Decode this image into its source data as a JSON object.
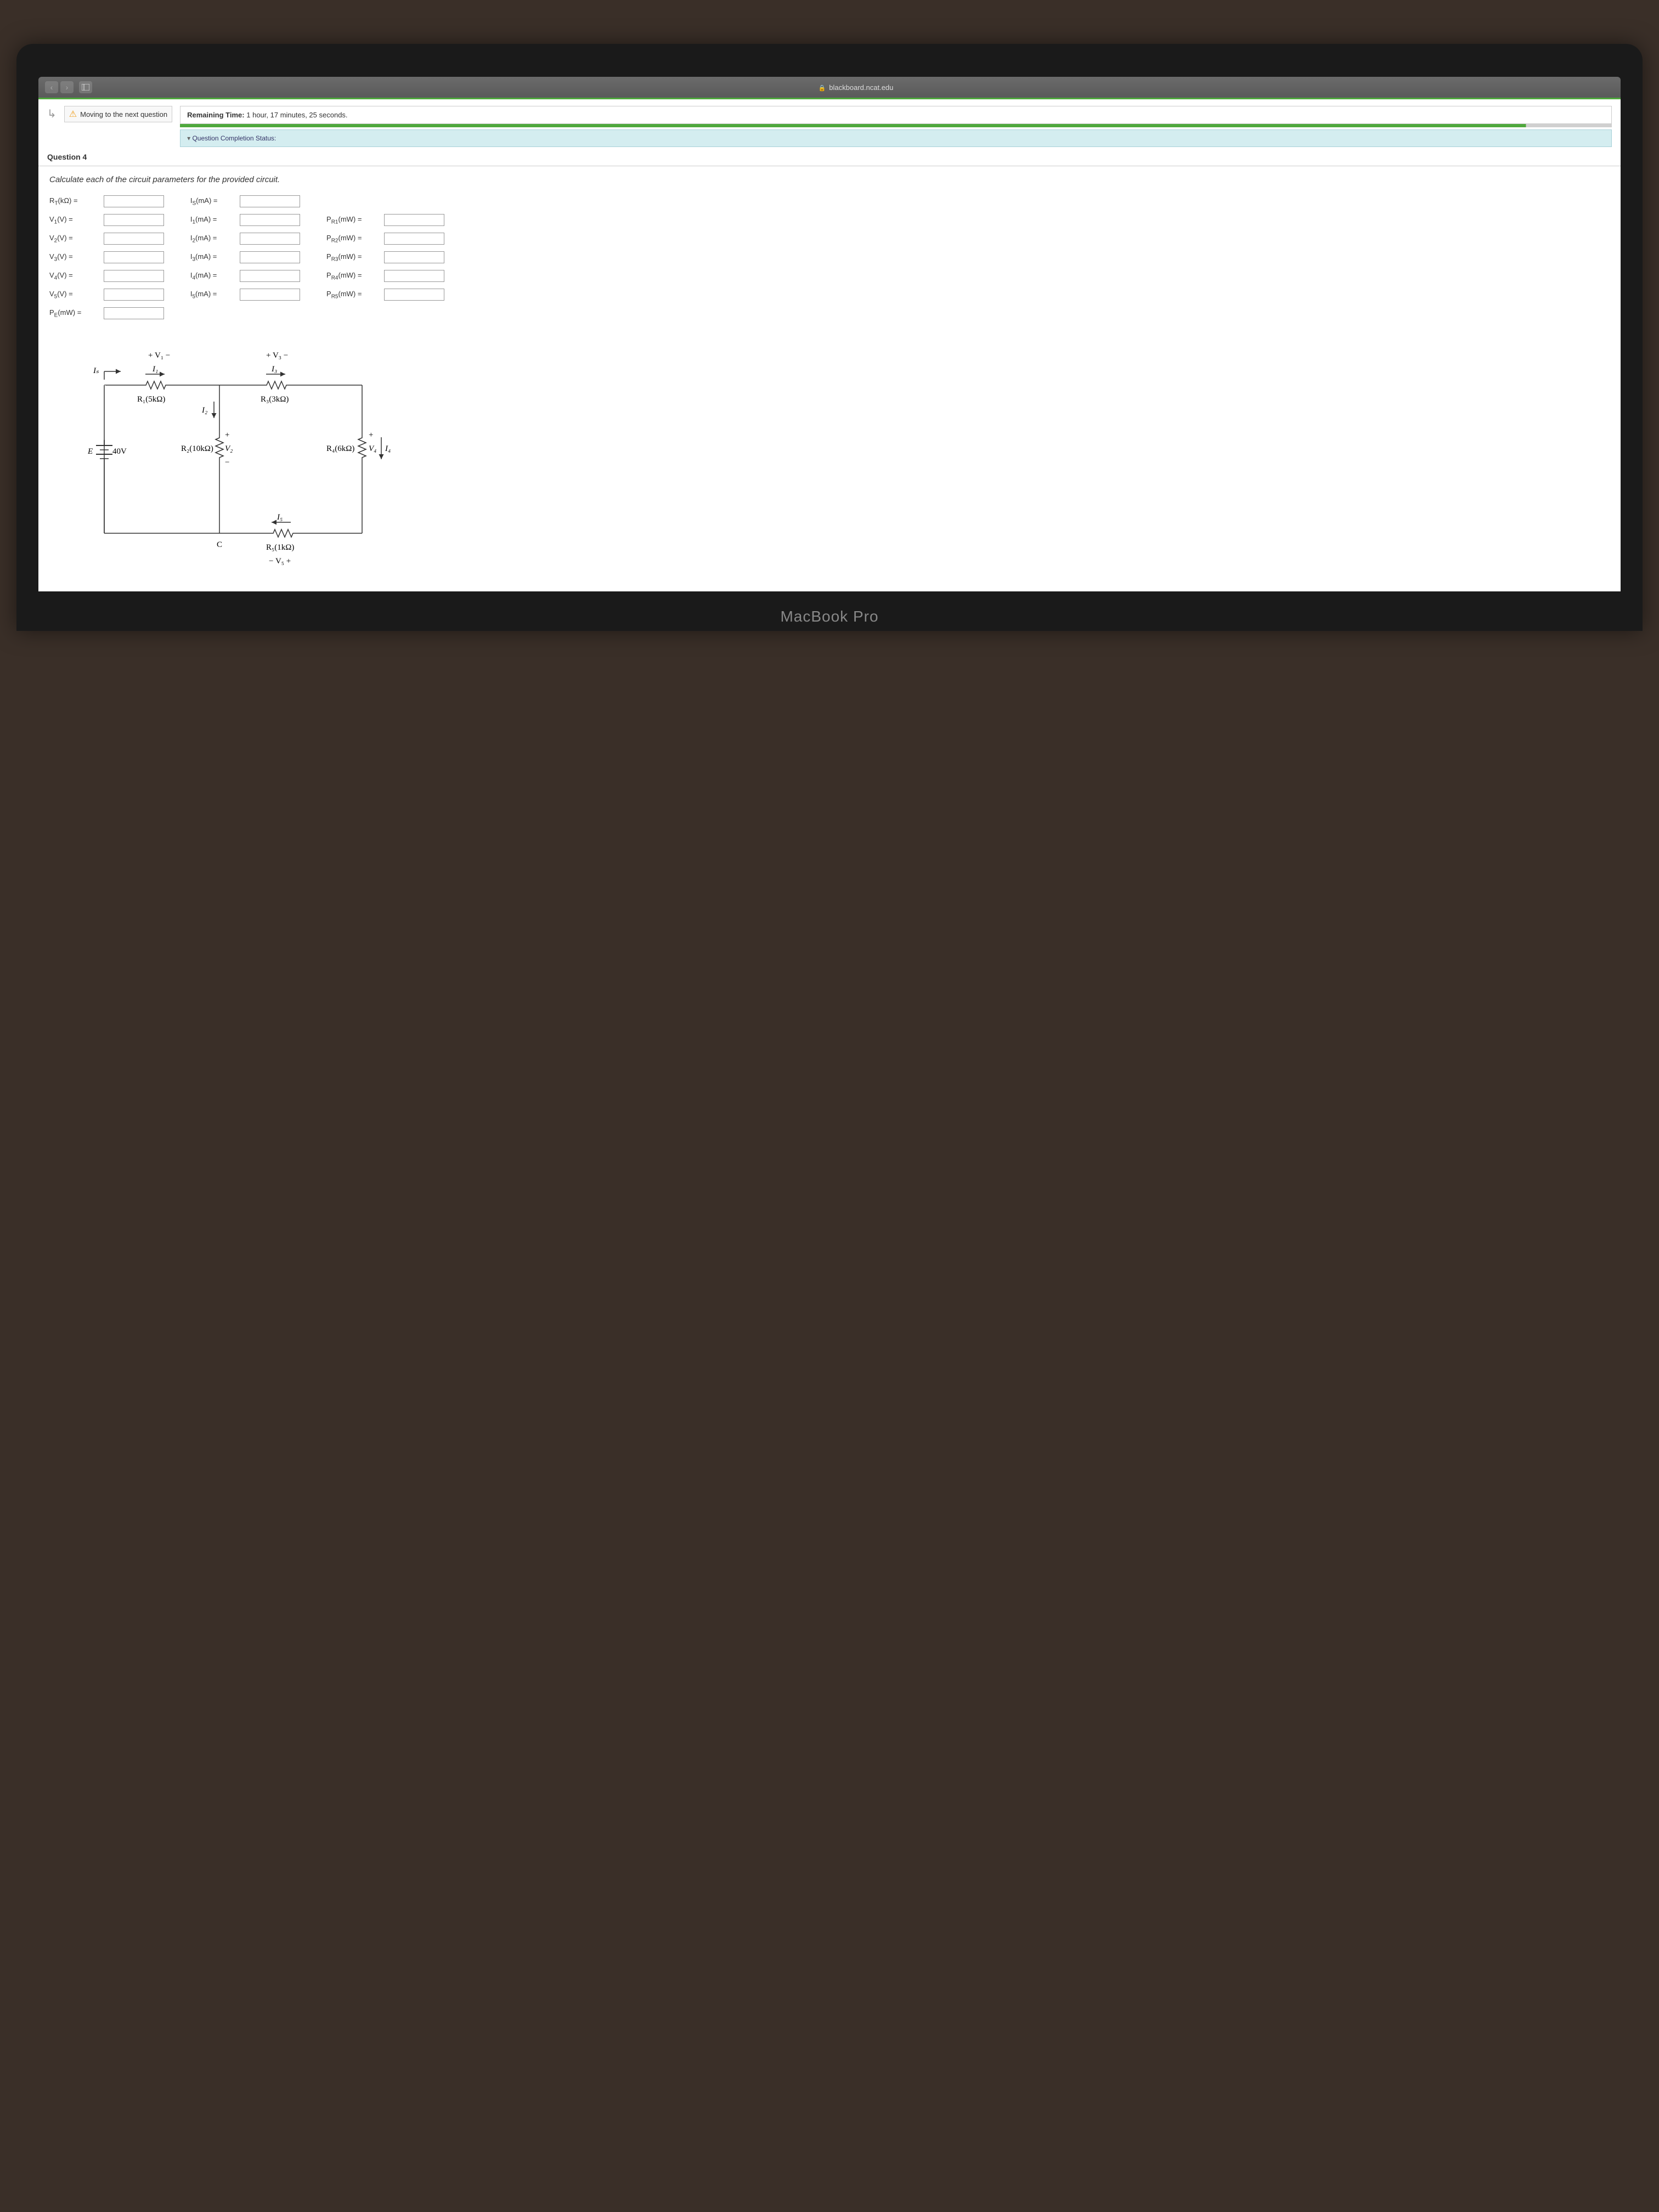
{
  "browser": {
    "url": "blackboard.ncat.edu"
  },
  "header": {
    "moving_text": "Moving to the next question",
    "remaining_label": "Remaining Time:",
    "remaining_value": "1 hour, 17 minutes, 25 seconds.",
    "completion_status": "Question Completion Status:"
  },
  "question": {
    "number": "Question 4",
    "instruction": "Calculate each of the circuit parameters for the provided circuit."
  },
  "params": {
    "col1": [
      {
        "label": "R<sub>T</sub>(kΩ) ="
      },
      {
        "label": "V<sub>1</sub>(V) ="
      },
      {
        "label": "V<sub>2</sub>(V) ="
      },
      {
        "label": "V<sub>3</sub>(V) ="
      },
      {
        "label": "V<sub>4</sub>(V) ="
      },
      {
        "label": "V<sub>5</sub>(V) ="
      },
      {
        "label": "P<sub>E</sub>(mW) ="
      }
    ],
    "col2": [
      {
        "label": "I<sub>S</sub>(mA) ="
      },
      {
        "label": "I<sub>1</sub>(mA) ="
      },
      {
        "label": "I<sub>2</sub>(mA) ="
      },
      {
        "label": "I<sub>3</sub>(mA) ="
      },
      {
        "label": "I<sub>4</sub>(mA) ="
      },
      {
        "label": "I<sub>5</sub>(mA) ="
      }
    ],
    "col3": [
      {
        "label": ""
      },
      {
        "label": "P<sub>R1</sub>(mW) ="
      },
      {
        "label": "P<sub>R2</sub>(mW) ="
      },
      {
        "label": "P<sub>R3</sub>(mW) ="
      },
      {
        "label": "P<sub>R4</sub>(mW) ="
      },
      {
        "label": "P<sub>R5</sub>(mW) ="
      }
    ]
  },
  "circuit": {
    "labels": {
      "v1": "+ V₁ −",
      "v3": "+ V₃ −",
      "v5": "− V₅ +",
      "is": "Iₛ",
      "i1": "I₁",
      "i2": "I₂",
      "i3": "I₃",
      "i4": "I₄",
      "i5": "I₅",
      "r1": "R₁(5kΩ)",
      "r2": "R₂(10kΩ)",
      "r3": "R₃(3kΩ)",
      "r4": "R₄(6kΩ)",
      "r5": "R₅(1kΩ)",
      "e": "E",
      "ev": "40V",
      "v2": "V₂",
      "v4": "V₄",
      "c": "C"
    }
  },
  "device": {
    "label": "MacBook Pro"
  }
}
